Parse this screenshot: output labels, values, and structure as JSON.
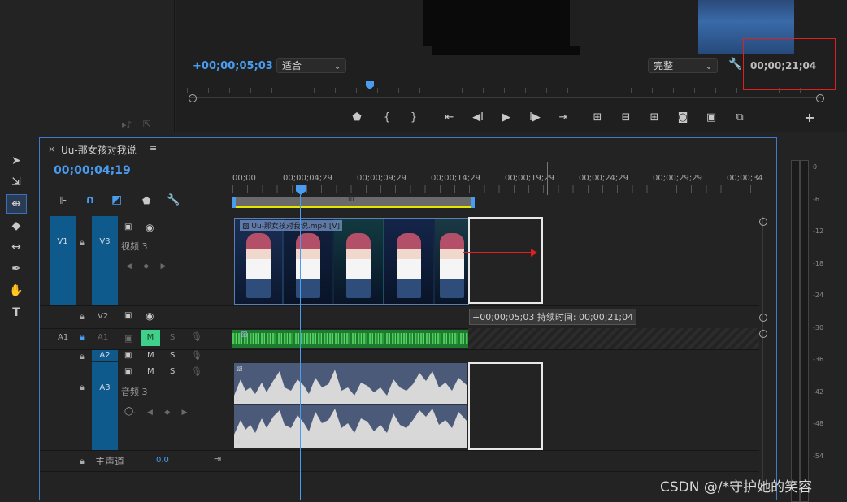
{
  "monitor": {
    "playhead_timecode": "+00;00;05;03",
    "fit_select": "适合",
    "quality_select": "完整",
    "duration_timecode": "00;00;21;04"
  },
  "sequence": {
    "name": "Uu-那女孩对我说",
    "timecode": "00;00;04;19",
    "ruler": [
      "00;00",
      "00;00;04;29",
      "00;00;09;29",
      "00;00;14;29",
      "00;00;19;29",
      "00;00;24;29",
      "00;00;29;29",
      "00;00;34"
    ]
  },
  "tracks": {
    "v1": "V1",
    "v3": "V3",
    "v3_name": "视频 3",
    "v2": "V2",
    "a1_src": "A1",
    "a1": "A1",
    "a2": "A2",
    "a3": "A3",
    "a3_name": "音频 3",
    "m_label": "M",
    "s_label": "S",
    "master": "主声道",
    "master_value": "0.0"
  },
  "clip": {
    "video_name": "Uu-那女孩对我说.mp4 [V]"
  },
  "tooltip": {
    "text": "+00;00;05;03 持续时间: 00;00;21;04"
  },
  "meters": [
    "0",
    "-6",
    "-12",
    "-18",
    "-24",
    "-30",
    "-36",
    "-42",
    "-48",
    "-54"
  ],
  "watermark": "CSDN @/*守护她的笑容"
}
